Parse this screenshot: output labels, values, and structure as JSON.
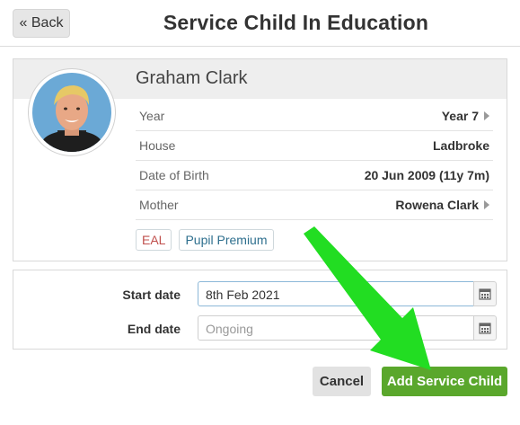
{
  "header": {
    "back_label": "« Back",
    "title": "Service Child In Education"
  },
  "student": {
    "name": "Graham Clark",
    "details": [
      {
        "label": "Year",
        "value": "Year 7",
        "link": true
      },
      {
        "label": "House",
        "value": "Ladbroke",
        "link": false
      },
      {
        "label": "Date of Birth",
        "value": "20 Jun 2009 (11y 7m)",
        "link": false
      },
      {
        "label": "Mother",
        "value": "Rowena Clark",
        "link": true
      }
    ],
    "tags": [
      "EAL",
      "Pupil Premium"
    ]
  },
  "form": {
    "start_label": "Start date",
    "start_value": "8th Feb 2021",
    "end_label": "End date",
    "end_placeholder": "Ongoing"
  },
  "actions": {
    "cancel_label": "Cancel",
    "add_label": "Add Service Child"
  },
  "colors": {
    "accent_green": "#5aa72c",
    "annotation_arrow": "#22dd22",
    "eal_tag": "#c0504d",
    "pupil_premium_tag": "#2e6f8e"
  }
}
